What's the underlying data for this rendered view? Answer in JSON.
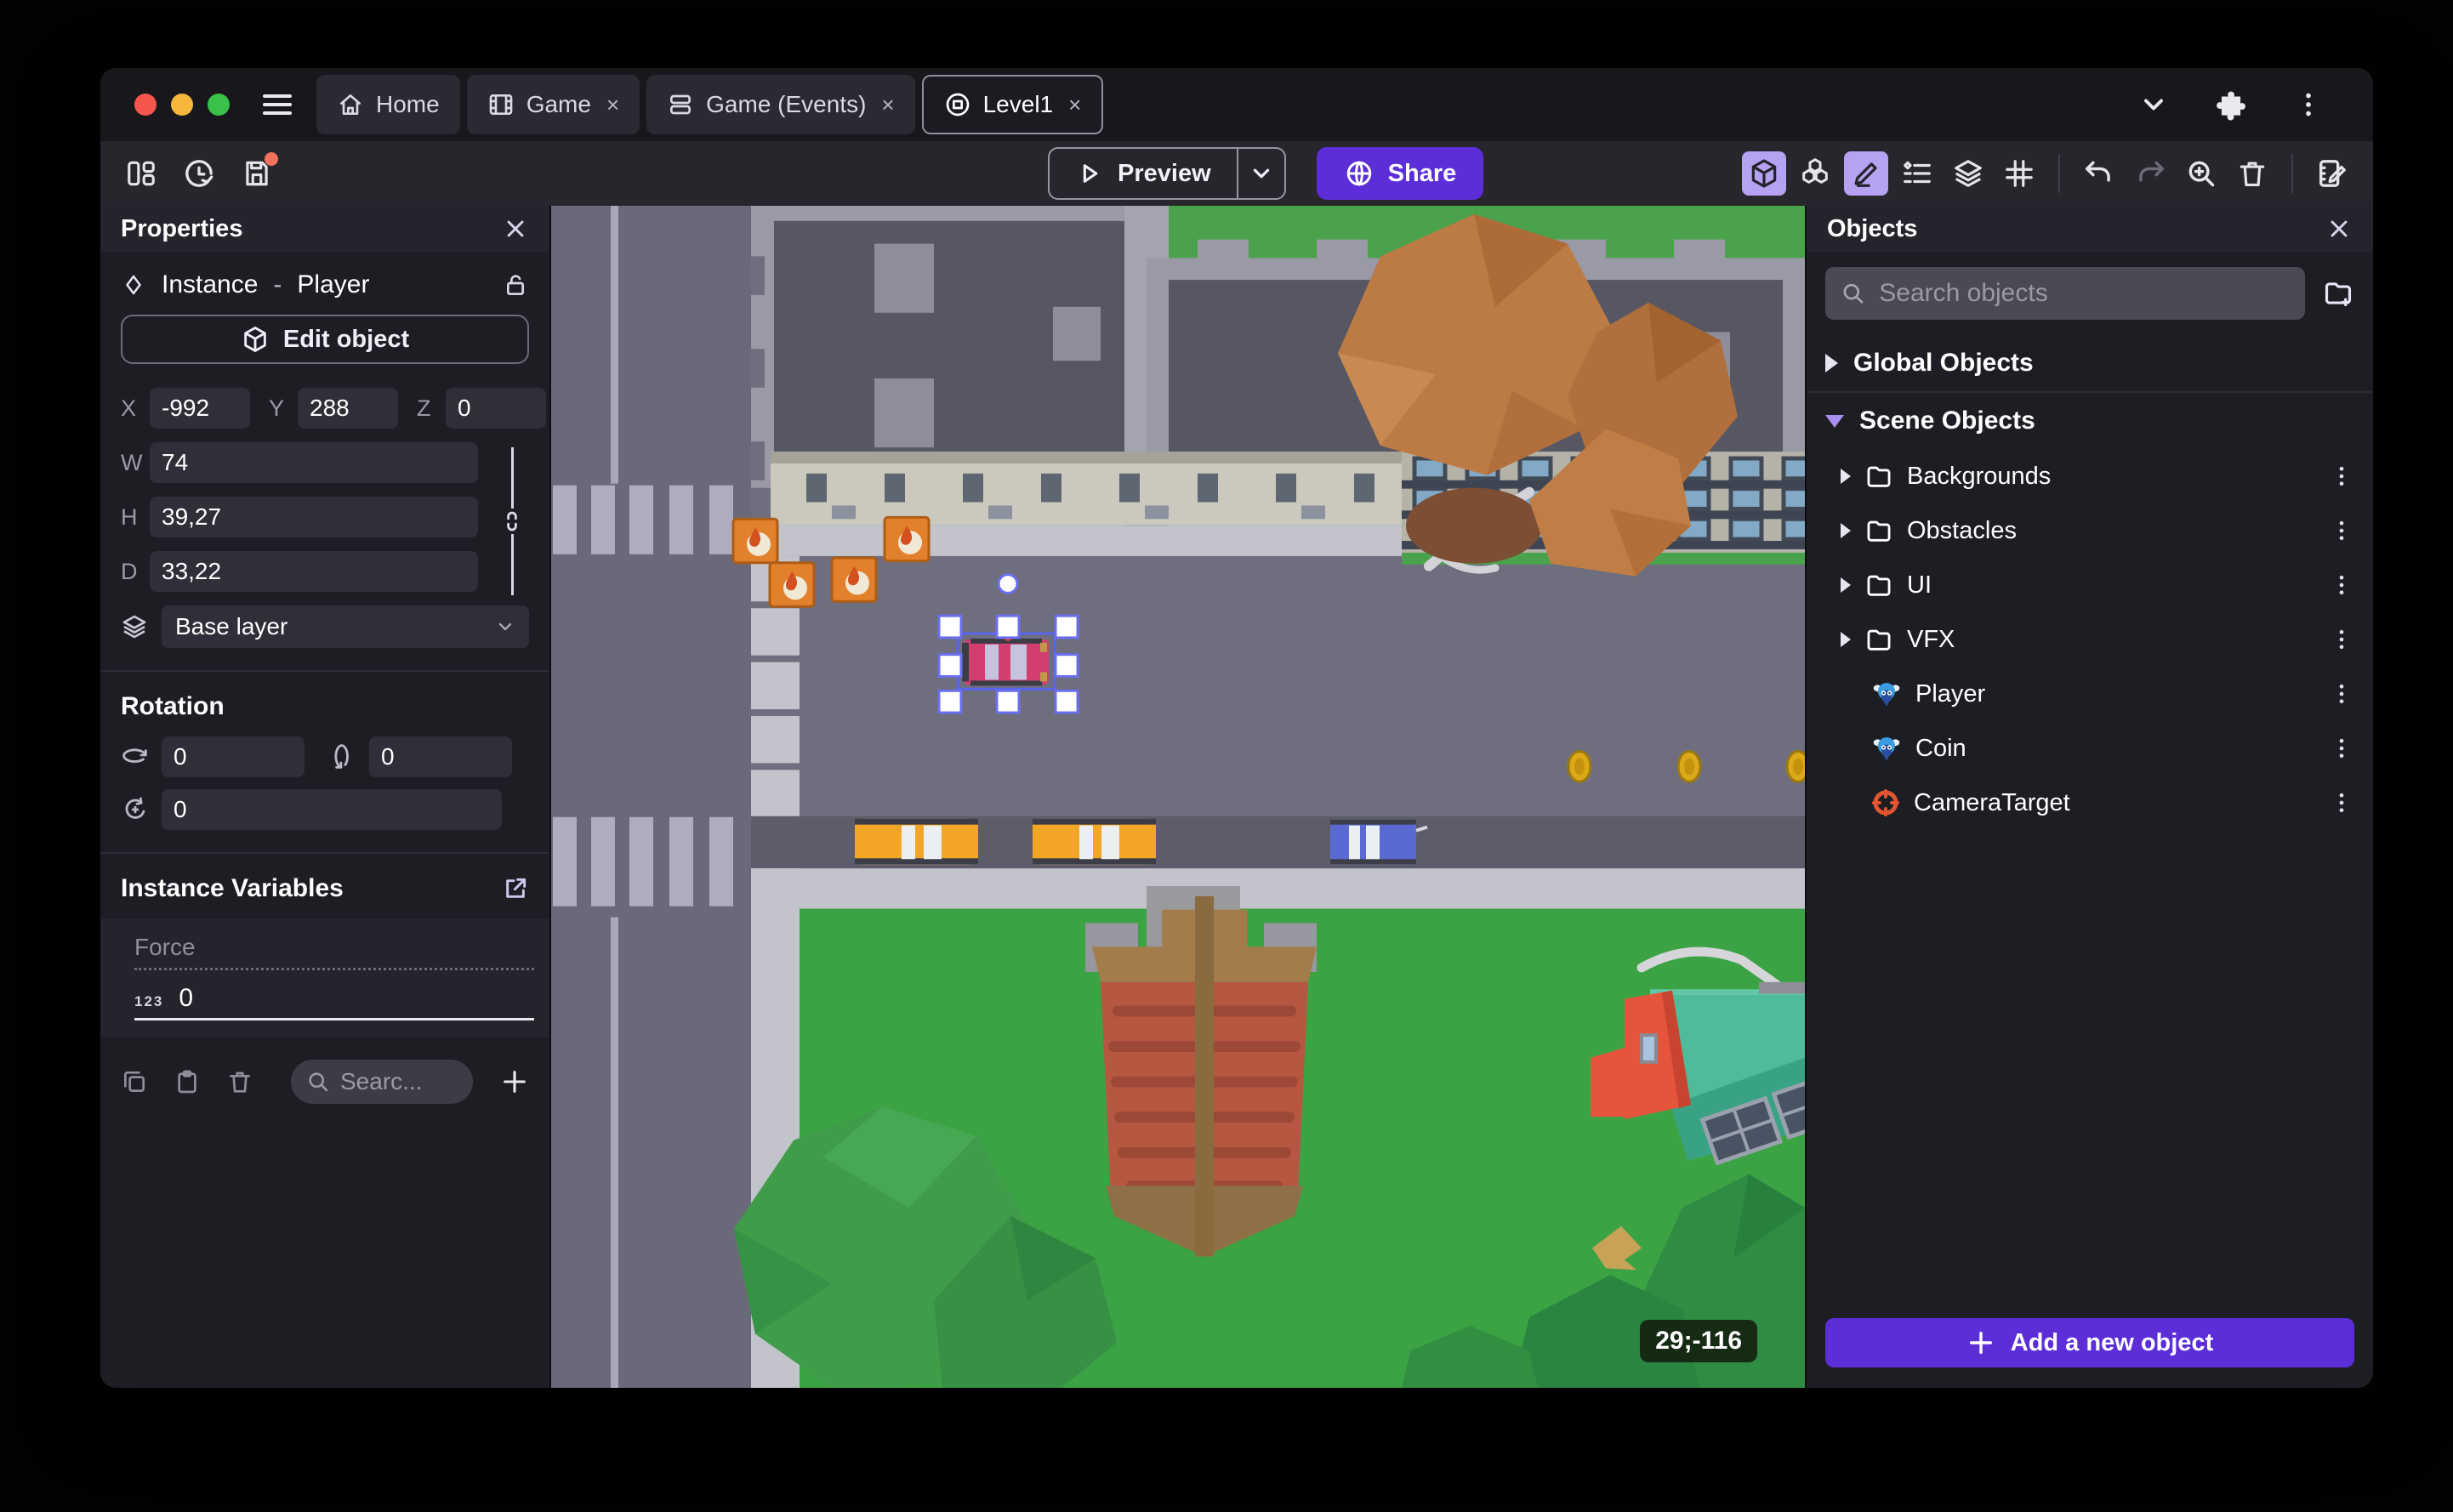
{
  "tab_bar": {
    "traffic_lights": {
      "red": "#f4564e",
      "yellow": "#f6b73c",
      "green": "#39c149"
    },
    "tabs": [
      {
        "label": "Home",
        "icon": "home-icon",
        "closable": false,
        "active": false
      },
      {
        "label": "Game",
        "icon": "film-icon",
        "closable": true,
        "active": false,
        "close": "×"
      },
      {
        "label": "Game (Events)",
        "icon": "events-sheet-icon",
        "closable": true,
        "active": false,
        "close": "×"
      },
      {
        "label": "Level1",
        "icon": "scene-icon",
        "closable": true,
        "active": true,
        "close": "×"
      }
    ],
    "right_icons": [
      "chevron-down-icon",
      "extensions-icon",
      "kebab-menu-icon"
    ]
  },
  "toolbar": {
    "left_icons": [
      "panels-layout-icon",
      "history-icon",
      "save-icon"
    ],
    "save_unsaved_dot": true,
    "preview_label": "Preview",
    "share_label": "Share",
    "right_icons": [
      "3d-view-icon (active)",
      "objects-cubes-icon",
      "edit-pencil-icon (active)",
      "instances-list-icon",
      "layers-icon",
      "grid-icon",
      "undo-icon",
      "redo-icon (disabled)",
      "zoom-in-icon",
      "trash-icon",
      "scene-properties-icon"
    ],
    "accent": "#5b2ed8",
    "active_icon_bg": "#b5a2f2"
  },
  "properties_panel": {
    "title": "Properties",
    "close": "×",
    "instance": {
      "kind": "Instance",
      "separator": "-",
      "object_name": "Player"
    },
    "edit_object_label": "Edit object",
    "position": {
      "x_label": "X",
      "x": "-992",
      "y_label": "Y",
      "y": "288",
      "z_label": "Z",
      "z": "0"
    },
    "size": {
      "w_label": "W",
      "w": "74",
      "h_label": "H",
      "h": "39,27",
      "d_label": "D",
      "d": "33,22",
      "linked": true
    },
    "layer": {
      "value": "Base layer"
    },
    "rotation": {
      "title": "Rotation",
      "rx": "0",
      "ry": "0",
      "rz": "0"
    },
    "instance_variables": {
      "title": "Instance Variables",
      "variable": {
        "name": "Force",
        "type_badge": "123",
        "value": "0"
      },
      "search_placeholder": "Searc...",
      "footer_icons": [
        "copy-icon",
        "paste-icon",
        "trash-icon",
        "search-icon",
        "add-icon"
      ]
    }
  },
  "objects_panel": {
    "title": "Objects",
    "close": "×",
    "search_placeholder": "Search objects",
    "global_group_label": "Global Objects",
    "scene_group_label": "Scene Objects",
    "scene_objects": [
      {
        "label": "Backgrounds",
        "kind": "folder"
      },
      {
        "label": "Obstacles",
        "kind": "folder"
      },
      {
        "label": "UI",
        "kind": "folder"
      },
      {
        "label": "VFX",
        "kind": "folder"
      },
      {
        "label": "Player",
        "kind": "object-3d"
      },
      {
        "label": "Coin",
        "kind": "object-3d"
      },
      {
        "label": "CameraTarget",
        "kind": "camera-target"
      }
    ],
    "add_button_label": "Add a new object"
  },
  "canvas": {
    "coords_badge": "29;-116",
    "colors": {
      "road": "#6e6e7e",
      "road_dark_strip": "#5c5c6b",
      "sidewalk": "#c3c3cb",
      "lawn": "#3ca344",
      "grass_top": "#4ba24c",
      "building_roof": "#575764",
      "building_parapet": "#9a9aa7",
      "facade_beige": "#cbc8be",
      "player_car": "#d23e6f",
      "taxi": "#f1a626",
      "blue_car": "#5a6ad2",
      "coin": "#dca91b",
      "crate": "#e2802b",
      "tower_brick": "#b65741",
      "house_roof": "#4fbb9a",
      "house_wall": "#e5543b",
      "tree_green": "#3f9d4a",
      "tree_autumn": "#bc7a44",
      "selection": "#5a64ec"
    }
  }
}
